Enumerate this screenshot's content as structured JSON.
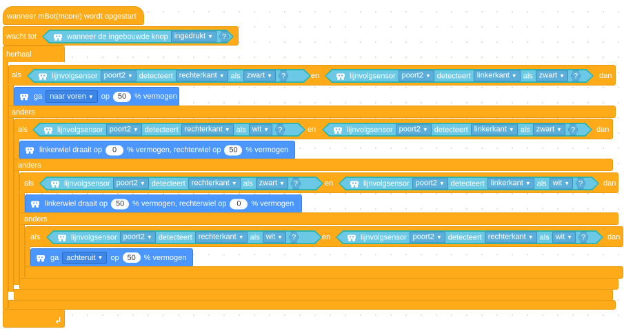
{
  "hat": {
    "label": "wanneer mBot(mcore) wordt opgestart"
  },
  "wait": {
    "label": "wacht tot",
    "sensor_text": "wanneer de ingebouwde knop",
    "state": "ingedrukt",
    "q": "?"
  },
  "repeat": {
    "label": "herhaal"
  },
  "common": {
    "als": "als",
    "en": "en",
    "dan": "dan",
    "anders": "anders",
    "sensor": "lijnvolgsensor",
    "port": "poort2",
    "detects": "detecteert",
    "right": "rechterkant",
    "left": "linkerkant",
    "als_small": "als",
    "q": "?",
    "pct": "% vermogen",
    "op": "op",
    "ga": "ga"
  },
  "if1": {
    "right_color": "zwart",
    "left_color": "zwart",
    "action": {
      "dir": "naar voren",
      "power": "50"
    }
  },
  "if2": {
    "right_color": "wit",
    "left_color": "zwart",
    "action": {
      "lw_label": "linkerwiel draait op",
      "lw": "0",
      "mid": "% vermogen, rechterwiel op",
      "rw": "50",
      "end": "% vermogen"
    }
  },
  "if3": {
    "right_color": "zwart",
    "left_color": "wit",
    "action": {
      "lw_label": "linkerwiel draait op",
      "lw": "50",
      "mid": "% vermogen, rechterwiel op",
      "rw": "0",
      "end": "% vermogen"
    }
  },
  "if4": {
    "right_color": "wit",
    "left_color": "wit",
    "action": {
      "dir": "achteruit",
      "power": "50"
    }
  },
  "icons": {
    "robot": "mbot-robot-icon",
    "loop": "loop-arrow-icon",
    "dropdown": "triangle-down"
  },
  "colors": {
    "control": "#ffab19",
    "action": "#4c97ff",
    "sensor": "#6bc9e6",
    "sensor_border": "#2fb5b0"
  }
}
